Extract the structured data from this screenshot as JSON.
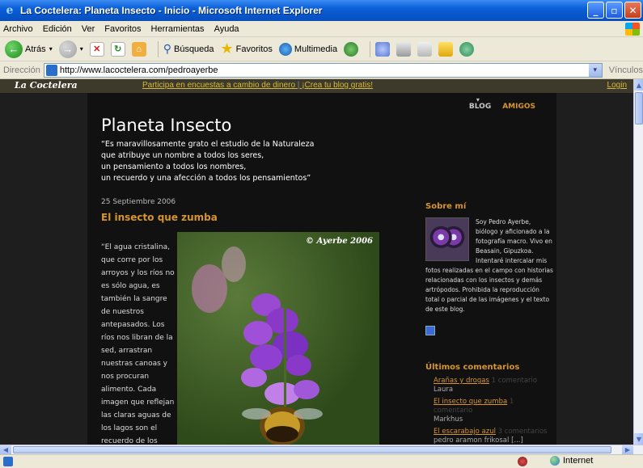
{
  "window": {
    "title": "La Coctelera: Planeta Insecto - Inicio - Microsoft Internet Explorer"
  },
  "menu": [
    "Archivo",
    "Edición",
    "Ver",
    "Favoritos",
    "Herramientas",
    "Ayuda"
  ],
  "toolbar": {
    "back_label": "Atrás",
    "search_label": "Búsqueda",
    "favorites_label": "Favoritos",
    "media_label": "Multimedia"
  },
  "address": {
    "label": "Dirección",
    "url": "http://www.lacoctelera.com/pedroayerbe",
    "links_label": "Vínculos"
  },
  "site_nav": {
    "brand": "La Coctelera",
    "promo_1": "Participa en encuestas a cambio de dinero",
    "promo_2": "¡Crea tu blog gratis!",
    "login": "Login"
  },
  "blog": {
    "nav_blog": "BLOG",
    "nav_friends": "AMIGOS",
    "title": "Planeta Insecto",
    "tagline_1": "“Es maravillosamente grato el estudio de la Naturaleza",
    "tagline_2": "que atribuye un nombre a todos los seres,",
    "tagline_3": "un pensamiento a todos los nombres,",
    "tagline_4": "un recuerdo y una afección a todos los pensamientos”"
  },
  "post": {
    "date": "25 Septiembre 2006",
    "title": "El insecto que zumba",
    "text": "“El agua cristalina, que corre por los arroyos y los ríos no es sólo agua, es también la sangre de nuestros antepasados. Los ríos nos libran de la sed, arrastran nuestras canoas y nos procuran alimento. Cada imagen que reflejan las claras aguas de los lagos son el recuerdo de los hechos que ocurrieron y la memoria de mis",
    "photo_credit": "© Ayerbe 2006"
  },
  "sidebar": {
    "about_heading": "Sobre mí",
    "bio": "Soy Pedro Ayerbe, biólogo y aficionado a la fotografía macro. Vivo en Beasain, Gipuzkoa. Intentaré intercalar mis fotos realizadas en el campo con historias relacionadas con los insectos y demás artrópodos. Prohibida la reproducción total o parcial de las imágenes y el texto de este blog.",
    "comments_heading": "Últimos comentarios",
    "comments": [
      {
        "title": "Arañas y drogas",
        "meta": "1 comentario",
        "author": "Laura"
      },
      {
        "title": "El insecto que zumba",
        "meta": "1 comentario",
        "author": "Markhus"
      },
      {
        "title": "El escarabajo azul",
        "meta": "3 comentarios",
        "author": "pedro aramon frikosal [...]"
      }
    ]
  },
  "status": {
    "zone": "Internet"
  },
  "colors": {
    "accent": "#d6952e",
    "page_bg": "#111111",
    "outer_bg": "#1e1e1e",
    "titlebar": "#0a5fd8"
  }
}
